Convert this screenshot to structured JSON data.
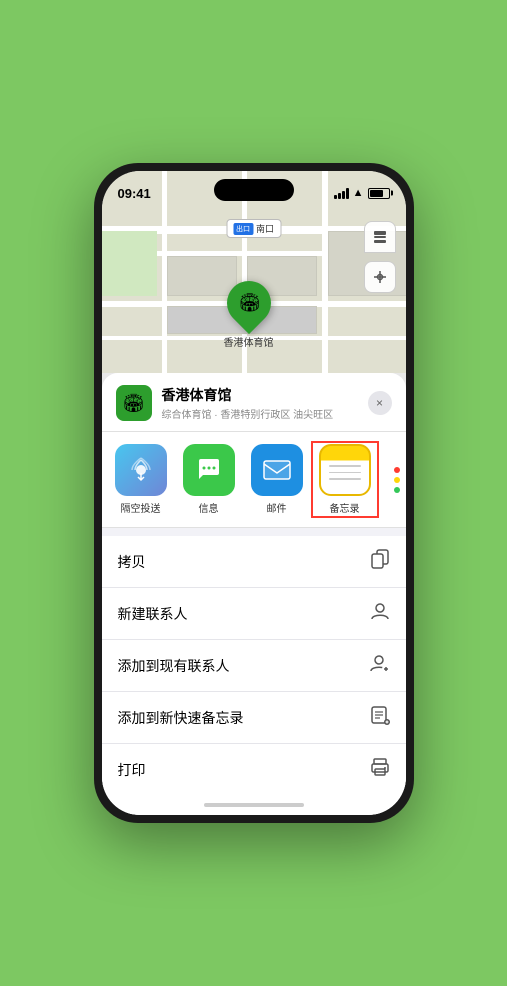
{
  "phone": {
    "time": "09:41",
    "location_arrow": "▶"
  },
  "map": {
    "label_badge": "出口",
    "label_text": "南口",
    "pin_emoji": "🏟",
    "pin_label": "香港体育馆"
  },
  "map_controls": {
    "layers_icon": "🗺",
    "location_icon": "◎"
  },
  "venue": {
    "icon_emoji": "🏟",
    "name": "香港体育馆",
    "desc": "综合体育馆 · 香港特别行政区 油尖旺区",
    "close_label": "×"
  },
  "share_apps": [
    {
      "id": "airdrop",
      "label": "隔空投送",
      "type": "airdrop"
    },
    {
      "id": "messages",
      "label": "信息",
      "type": "messages"
    },
    {
      "id": "mail",
      "label": "邮件",
      "type": "mail"
    },
    {
      "id": "notes",
      "label": "备忘录",
      "type": "notes",
      "selected": true
    }
  ],
  "more_dots": {
    "colors": [
      "#ff3b30",
      "#ffd60a",
      "#34c759"
    ]
  },
  "actions": [
    {
      "id": "copy",
      "label": "拷贝",
      "icon": "⧉"
    },
    {
      "id": "new-contact",
      "label": "新建联系人",
      "icon": "👤"
    },
    {
      "id": "add-existing",
      "label": "添加到现有联系人",
      "icon": "👤"
    },
    {
      "id": "add-notes",
      "label": "添加到新快速备忘录",
      "icon": "📋"
    },
    {
      "id": "print",
      "label": "打印",
      "icon": "🖨"
    }
  ]
}
